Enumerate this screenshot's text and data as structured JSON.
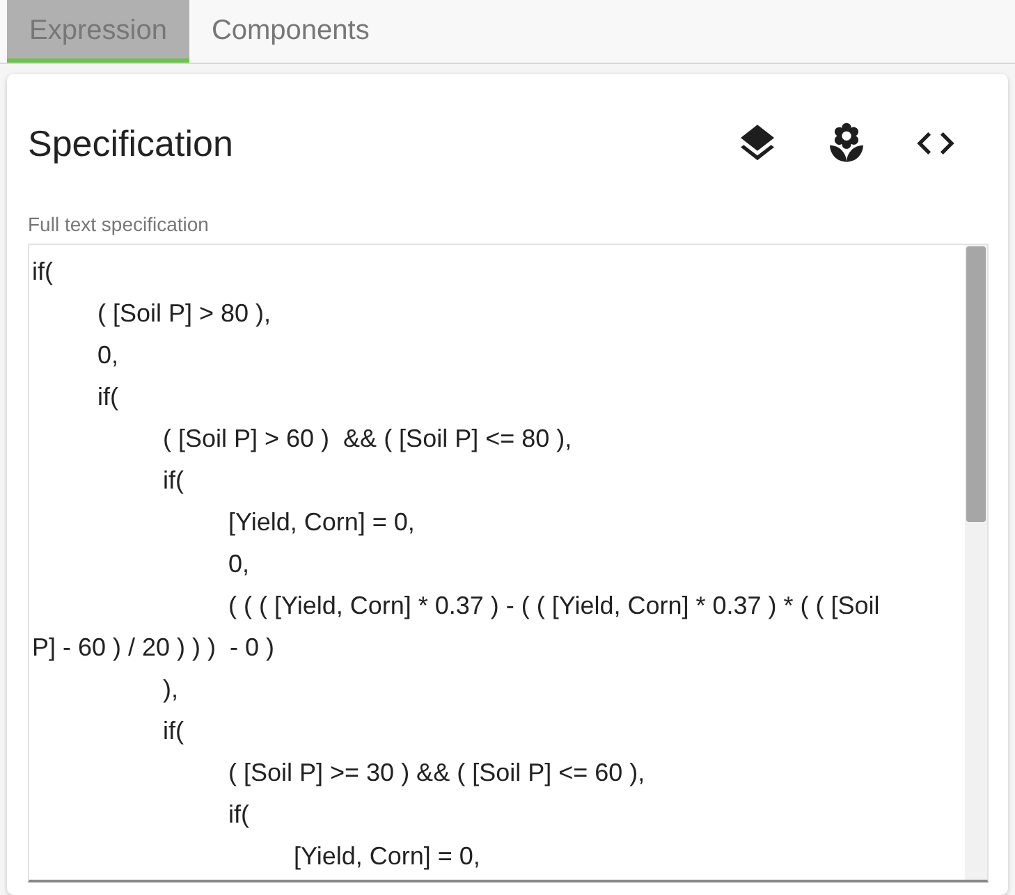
{
  "tabs": [
    {
      "label": "Expression",
      "selected": true
    },
    {
      "label": "Components",
      "selected": false
    }
  ],
  "card": {
    "title": "Specification",
    "actions": [
      {
        "kind": "layers"
      },
      {
        "kind": "flower"
      },
      {
        "kind": "code"
      }
    ],
    "field": {
      "label": "Full text specification",
      "value": "if(\n\t( [Soil P] > 80 ),\n\t0,\n\tif(\n\t\t( [Soil P] > 60 )  && ( [Soil P] <= 80 ),\n\t\tif(\n\t\t\t[Yield, Corn] = 0,\n\t\t\t0,\n\t\t\t( ( ( [Yield, Corn] * 0.37 ) - ( ( [Yield, Corn] * 0.37 ) * ( ( [Soil P] - 60 ) / 20 ) ) )  - 0 )\n\t\t),\n\t\tif(\n\t\t\t( [Soil P] >= 30 ) && ( [Soil P] <= 60 ),\n\t\t\tif(\n\t\t\t\t[Yield, Corn] = 0,"
    }
  }
}
